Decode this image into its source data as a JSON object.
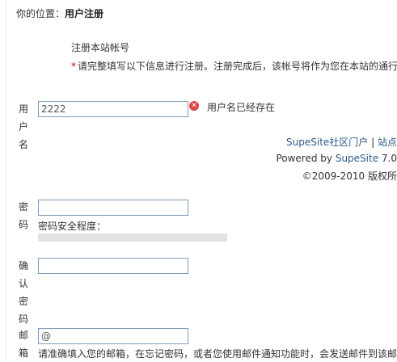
{
  "breadcrumb": {
    "prefix": "你的位置：",
    "current": "用户注册"
  },
  "form": {
    "title": "注册本站帐号",
    "notice_star": "*",
    "notice": "请完整填写以下信息进行注册。注册完成后，该帐号将作为您在本站的通行",
    "username": {
      "label_chars": [
        "用",
        "户",
        "名"
      ],
      "value": "2222",
      "error_message": "用户名已经存在"
    },
    "password": {
      "label_chars": [
        "密",
        "码"
      ],
      "value": "",
      "strength_label": "密码安全程度：",
      "strength_level": 0
    },
    "confirm_password": {
      "label_chars": [
        "确",
        "认",
        "密",
        "码"
      ],
      "value": ""
    },
    "email": {
      "label_chars": [
        "邮",
        "箱"
      ],
      "value": "@",
      "hint": "请准确填入您的邮箱，在忘记密码，或者您使用邮件通知功能时，会发送邮件到该邮"
    }
  },
  "footer": {
    "links_community": "SupeSite社区门户",
    "links_sep": "|",
    "links_site": "站点",
    "powered_prefix": "Powered by ",
    "powered_link": "SupeSite",
    "powered_version": " 7.0",
    "copyright": "©2009-2010  版权所"
  }
}
